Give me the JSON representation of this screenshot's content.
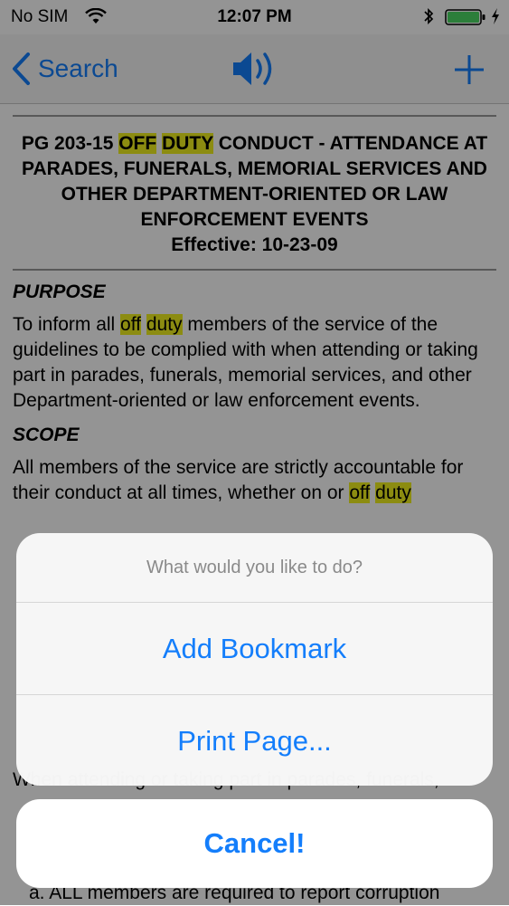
{
  "status_bar": {
    "carrier": "No SIM",
    "time": "12:07 PM"
  },
  "nav": {
    "back_label": "Search",
    "accent_color": "#147efb"
  },
  "document": {
    "title": {
      "prefix": "PG 203-15 ",
      "highlight_1": "OFF",
      "space": " ",
      "highlight_2": "DUTY",
      "suffix": " CONDUCT - ATTENDANCE AT PARADES, FUNERALS, MEMORIAL SERVICES AND OTHER DEPARTMENT-ORIENTED OR LAW ENFORCEMENT EVENTS",
      "effective": "Effective: 10-23-09"
    },
    "purpose_heading": "PURPOSE",
    "purpose": {
      "before": "To inform all ",
      "hl_1": "off",
      "between": " ",
      "hl_2": "duty",
      "after": " members of the service of the guidelines to be complied with when attending or taking part in parades, funerals, memorial services, and other Department-oriented or law enforcement events."
    },
    "scope_heading": "SCOPE",
    "scope": {
      "before": "All members of the service are strictly accountable for their conduct at all times, whether on or ",
      "hl_1": "off",
      "between": " ",
      "hl_2": "duty"
    },
    "body_line": "When attending or taking part in parades, funerals,",
    "list_item": "a. ALL members are required to report corruption"
  },
  "action_sheet": {
    "title": "What would you like to do?",
    "buttons": [
      "Add Bookmark",
      "Print Page..."
    ],
    "cancel": "Cancel!"
  }
}
